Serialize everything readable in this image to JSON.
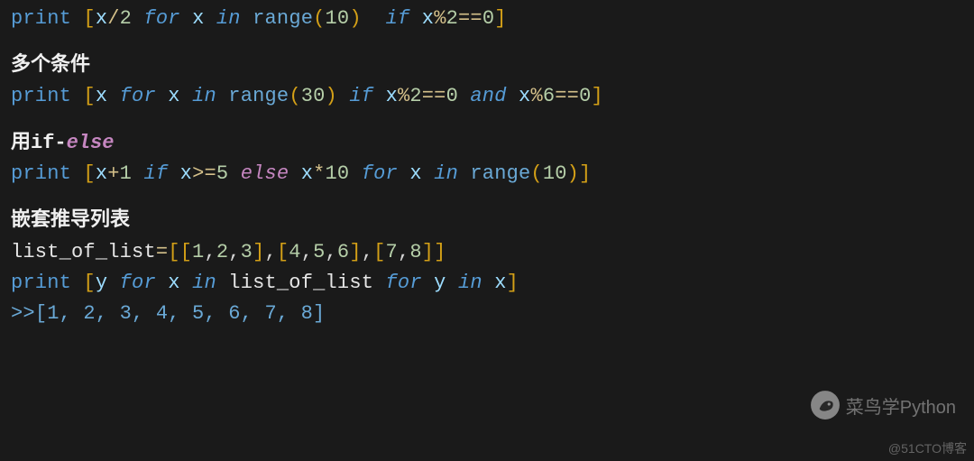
{
  "line1": {
    "print": "print ",
    "lb": "[",
    "x1": "x",
    "op_div": "/",
    "n2": "2",
    "sp1": " ",
    "for_kw": "for",
    "sp2": " ",
    "x2": "x",
    "sp3": " ",
    "in_kw": "in",
    "sp4": " ",
    "range": "range",
    "lp": "(",
    "n10": "10",
    "rp": ")",
    "sp5": "  ",
    "if_kw": "if",
    "sp6": " ",
    "x3": "x",
    "mod": "%",
    "n2b": "2",
    "eq": "==",
    "n0": "0",
    "rb": "]"
  },
  "heading2": "多个条件",
  "line2": {
    "print": "print ",
    "lb": "[",
    "x1": "x",
    "sp1": " ",
    "for_kw": "for",
    "sp2": " ",
    "x2": "x",
    "sp3": " ",
    "in_kw": "in",
    "sp4": " ",
    "range": "range",
    "lp": "(",
    "n30": "30",
    "rp": ")",
    "sp5": " ",
    "if_kw": "if",
    "sp6": " ",
    "x3": "x",
    "mod1": "%",
    "n2": "2",
    "eq1": "==",
    "n0a": "0",
    "sp7": " ",
    "and_kw": "and",
    "sp8": " ",
    "x4": "x",
    "mod2": "%",
    "n6": "6",
    "eq2": "==",
    "n0b": "0",
    "rb": "]"
  },
  "heading3": {
    "pre": "用if-",
    "else": "else"
  },
  "line3": {
    "print": "print ",
    "lb": "[",
    "x1": "x",
    "plus": "+",
    "n1": "1",
    "sp1": " ",
    "if_kw": "if",
    "sp2": " ",
    "x2": "x",
    "ge": ">=",
    "n5": "5",
    "sp3": " ",
    "else_kw": "else",
    "sp4": " ",
    "x3": "x",
    "mul": "*",
    "n10": "10",
    "sp5": " ",
    "for_kw": "for",
    "sp6": " ",
    "x4": "x",
    "sp7": " ",
    "in_kw": "in",
    "sp8": " ",
    "range": "range",
    "lp": "(",
    "n10b": "10",
    "rp": ")",
    "rb": "]"
  },
  "heading4": "嵌套推导列表",
  "line4a": {
    "id": "list_of_list",
    "eq": "=",
    "lb1": "[[",
    "n1": "1",
    "c1": ",",
    "n2": "2",
    "c2": ",",
    "n3": "3",
    "rb1": "]",
    "c3": ",",
    "lb2": "[",
    "n4": "4",
    "c4": ",",
    "n5": "5",
    "c5": ",",
    "n6": "6",
    "rb2": "]",
    "c6": ",",
    "lb3": "[",
    "n7": "7",
    "c7": ",",
    "n8": "8",
    "rb3": "]]"
  },
  "line4b": {
    "print": "print ",
    "lb": "[",
    "y1": "y",
    "sp1": " ",
    "for1": "for",
    "sp2": " ",
    "x1": "x",
    "sp3": " ",
    "in1": "in",
    "sp4": " ",
    "id": "list_of_list",
    "sp5": " ",
    "for2": "for",
    "sp6": " ",
    "y2": "y",
    "sp7": " ",
    "in2": "in",
    "sp8": " ",
    "x2": "x",
    "rb": "]"
  },
  "line4c": {
    "prompt": ">>",
    "out": "[1, 2, 3, 4, 5, 6, 7, 8]"
  },
  "watermark_logo_text": "菜鸟学Python",
  "watermark_bottom": "@51CTO博客"
}
